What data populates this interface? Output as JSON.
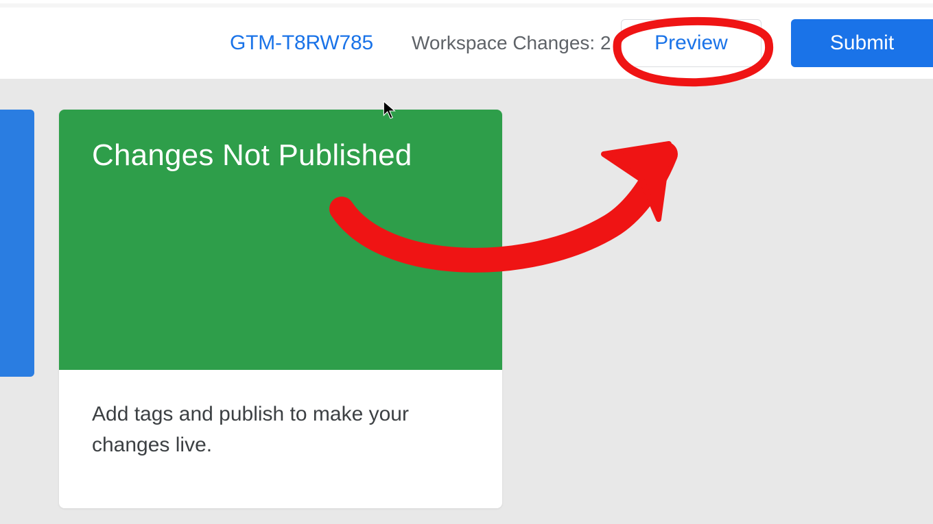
{
  "header": {
    "container_id": "GTM-T8RW785",
    "workspace_changes_label": "Workspace Changes: 2",
    "preview_label": "Preview",
    "submit_label": "Submit"
  },
  "card": {
    "title": "Changes Not Published",
    "body": "Add tags and publish to make your changes live."
  }
}
